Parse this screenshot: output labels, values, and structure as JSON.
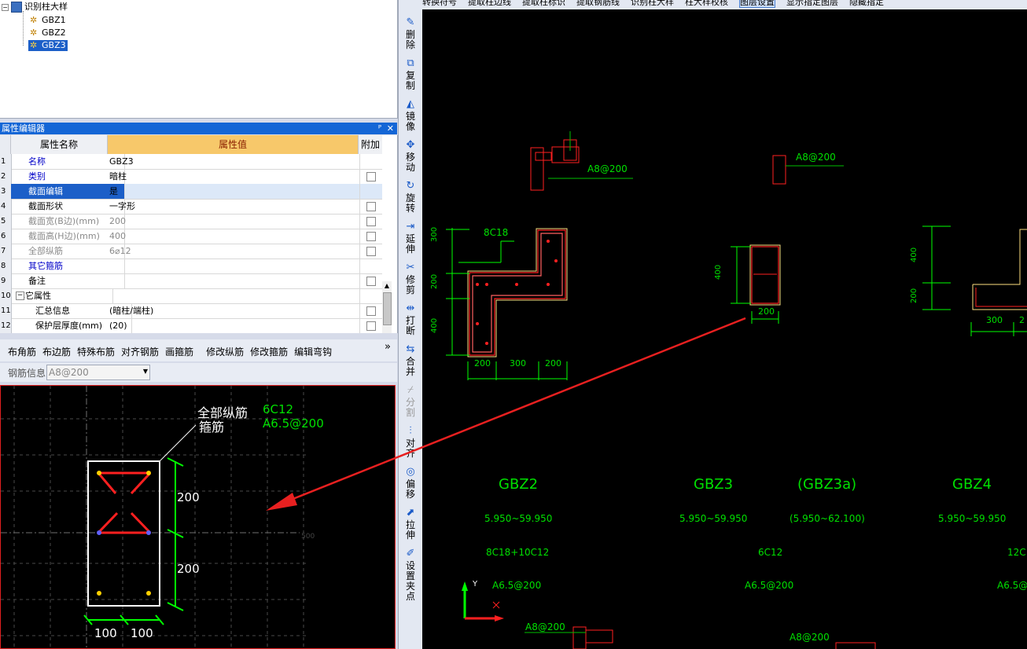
{
  "tree": {
    "root": "识别柱大样",
    "children": [
      "GBZ1",
      "GBZ2",
      "GBZ3"
    ],
    "selected": "GBZ3"
  },
  "prop_editor": {
    "title": "属性编辑器",
    "pin": "ᴾ",
    "close": "✕",
    "headers": [
      "属性名称",
      "属性值",
      "附加"
    ],
    "rows": [
      {
        "num": "1",
        "name": "名称",
        "value": "GBZ3",
        "check": false
      },
      {
        "num": "2",
        "name": "类别",
        "value": "暗柱",
        "check": true
      },
      {
        "num": "3",
        "name": "截面编辑",
        "value": "是",
        "check": false
      },
      {
        "num": "4",
        "name": "截面形状",
        "value": "一字形",
        "check": true
      },
      {
        "num": "5",
        "name": "截面宽(B边)(mm)",
        "value": "200",
        "check": true
      },
      {
        "num": "6",
        "name": "截面高(H边)(mm)",
        "value": "400",
        "check": true
      },
      {
        "num": "7",
        "name": "全部纵筋",
        "value": "6⌀12",
        "check": true
      },
      {
        "num": "8",
        "name": "其它箍筋",
        "value": "",
        "check": false
      },
      {
        "num": "9",
        "name": "备注",
        "value": "",
        "check": true
      },
      {
        "num": "10",
        "name": "其它属性",
        "value": "",
        "check": false
      },
      {
        "num": "11",
        "name": "汇总信息",
        "value": "(暗柱/端柱)",
        "check": true
      },
      {
        "num": "12",
        "name": "保护层厚度(mm)",
        "value": "(20)",
        "check": true
      }
    ]
  },
  "rebar_toolbar": {
    "buttons": [
      "布角筋",
      "布边筋",
      "特殊布筋",
      "对齐钢筋",
      "画箍筋",
      "修改纵筋",
      "修改箍筋",
      "编辑弯钩"
    ],
    "more": "»",
    "info_label": "钢筋信息",
    "info_value": "A8@200"
  },
  "section_view": {
    "label_long": "全部纵筋",
    "long_value": "6C12",
    "label_stirrup": "箍筋",
    "stirrup_value": "A6.5@200",
    "dim_h1": "200",
    "dim_h2": "200",
    "dim_w1": "100",
    "dim_w2": "100",
    "grid_label": "500"
  },
  "vertical_tools": [
    {
      "icon": "brush-icon",
      "label": "删除"
    },
    {
      "icon": "copy-icon",
      "label": "复制"
    },
    {
      "icon": "mirror-icon",
      "label": "镜像"
    },
    {
      "icon": "move-icon",
      "label": "移动"
    },
    {
      "icon": "rotate-icon",
      "label": "旋转"
    },
    {
      "icon": "extend-icon",
      "label": "延伸"
    },
    {
      "icon": "trim-icon",
      "label": "修剪"
    },
    {
      "icon": "break-icon",
      "label": "打断"
    },
    {
      "icon": "merge-icon",
      "label": "合并"
    },
    {
      "icon": "split-icon",
      "label": "分割"
    },
    {
      "icon": "align-icon",
      "label": "对齐"
    },
    {
      "icon": "offset-icon",
      "label": "偏移"
    },
    {
      "icon": "stretch-icon",
      "label": "拉伸"
    },
    {
      "icon": "grip-icon",
      "label": "设置夹点"
    }
  ],
  "top_toolbar": {
    "items": [
      "转换符号",
      "提取柱边线",
      "提取柱标识",
      "提取钢筋线",
      "识别柱大样",
      "柱大样校核",
      "图层设置",
      "显示指定图层",
      "隐藏指定"
    ]
  },
  "cad": {
    "labels_top": [
      "A8@200",
      "A8@200"
    ],
    "col1_label": "8C18",
    "col1_dims_v": [
      "300",
      "200",
      "400"
    ],
    "col1_dims_h": [
      "200",
      "300",
      "200"
    ],
    "col2_dim_v": "400",
    "col2_dim_h": "200",
    "col3_dims_v": [
      "400",
      "200"
    ],
    "col3_dims_h": [
      "300",
      "2"
    ],
    "tables": [
      {
        "name": "GBZ2",
        "elev": "5.950~59.950",
        "rebar": "8C18+10C12",
        "stirrup": "A6.5@200"
      },
      {
        "name": "GBZ3",
        "elev": "5.950~59.950",
        "rebar": "6C12",
        "stirrup": "A6.5@200"
      },
      {
        "name": "(GBZ3a)",
        "elev": "(5.950~62.100)",
        "rebar": "",
        "stirrup": ""
      },
      {
        "name": "GBZ4",
        "elev": "5.950~59.950",
        "rebar": "12C",
        "stirrup": "A6.5@"
      }
    ],
    "bottom_labels": [
      "A8@200",
      "A8@200"
    ],
    "axis_y": "Y"
  },
  "colors": {
    "green": "#00e000",
    "red": "#e00000",
    "titlebar": "#1466d6",
    "header_orange": "#f7c86a"
  }
}
